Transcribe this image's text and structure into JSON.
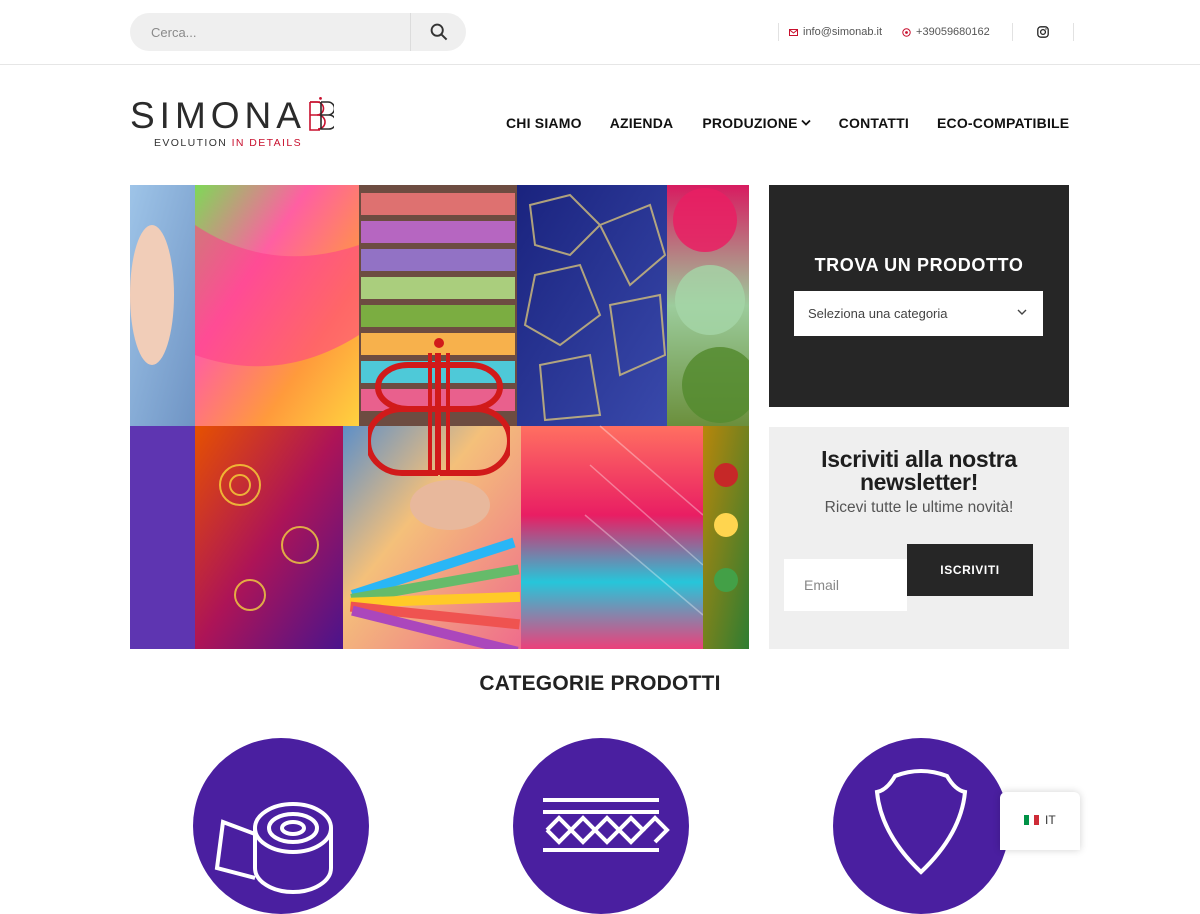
{
  "topbar": {
    "search_placeholder": "Cerca...",
    "email": "info@simonab.it",
    "phone": "+39059680162"
  },
  "logo": {
    "name": "SIMONA",
    "tagline_main": "EVOLUTION",
    "tagline_accent": "IN DETAILS"
  },
  "nav": {
    "items": [
      {
        "label": "CHI SIAMO"
      },
      {
        "label": "AZIENDA"
      },
      {
        "label": "PRODUZIONE"
      },
      {
        "label": "CONTATTI"
      },
      {
        "label": "ECO-COMPATIBILE"
      }
    ]
  },
  "finder": {
    "title": "TROVA UN PRODOTTO",
    "select_value": "Seleziona una categoria"
  },
  "newsletter": {
    "title": "Iscriviti alla nostra newsletter!",
    "subtitle": "Ricevi tutte le ultime novità!",
    "email_placeholder": "Email",
    "button_label": "ISCRIVITI"
  },
  "categories": {
    "title": "CATEGORIE PRODOTTI"
  },
  "language": {
    "code": "IT"
  },
  "colors": {
    "accent_red": "#c8102e",
    "dark_panel": "#262626",
    "category_purple": "#4a1fa0"
  }
}
